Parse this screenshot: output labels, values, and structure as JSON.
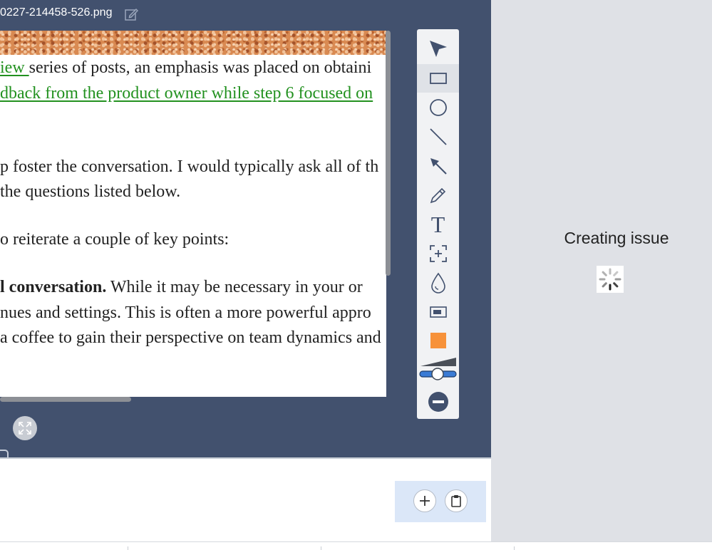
{
  "editor": {
    "filename": "0227-214458-526.png"
  },
  "document": {
    "line1_link": "iew ",
    "line1_text": "series of posts, an emphasis was placed on obtaini",
    "line2_link": "dback from the product owner while step 6 focused on",
    "line3": "p foster the conversation. I would typically ask all of th",
    "line4": "the questions listed below.",
    "line5": "o reiterate a couple of key points:",
    "line6_bold": "l conversation.",
    "line6_text": " While it may be necessary in your or",
    "line7": "nues and settings. This is often a more powerful appro",
    "line8": "a coffee to gain their perspective on team dynamics and"
  },
  "toolbar": {
    "tools": [
      {
        "name": "select-arrow-icon"
      },
      {
        "name": "rectangle-icon"
      },
      {
        "name": "ellipse-icon"
      },
      {
        "name": "line-icon"
      },
      {
        "name": "arrow-icon"
      },
      {
        "name": "pencil-icon"
      },
      {
        "name": "text-icon",
        "glyph": "T"
      },
      {
        "name": "crop-add-icon"
      },
      {
        "name": "blur-drop-icon"
      },
      {
        "name": "highlight-box-icon"
      },
      {
        "name": "color-swatch"
      },
      {
        "name": "size-slider"
      },
      {
        "name": "remove-icon"
      }
    ],
    "active_tool": "rectangle-icon",
    "color": "#f7923a"
  },
  "status": {
    "creating_text": "Creating issue"
  },
  "colors": {
    "editor_bg": "#42516e",
    "panel_bg": "#dfe1e6",
    "link": "#22911f",
    "accent_blue": "#3a7bd5"
  }
}
